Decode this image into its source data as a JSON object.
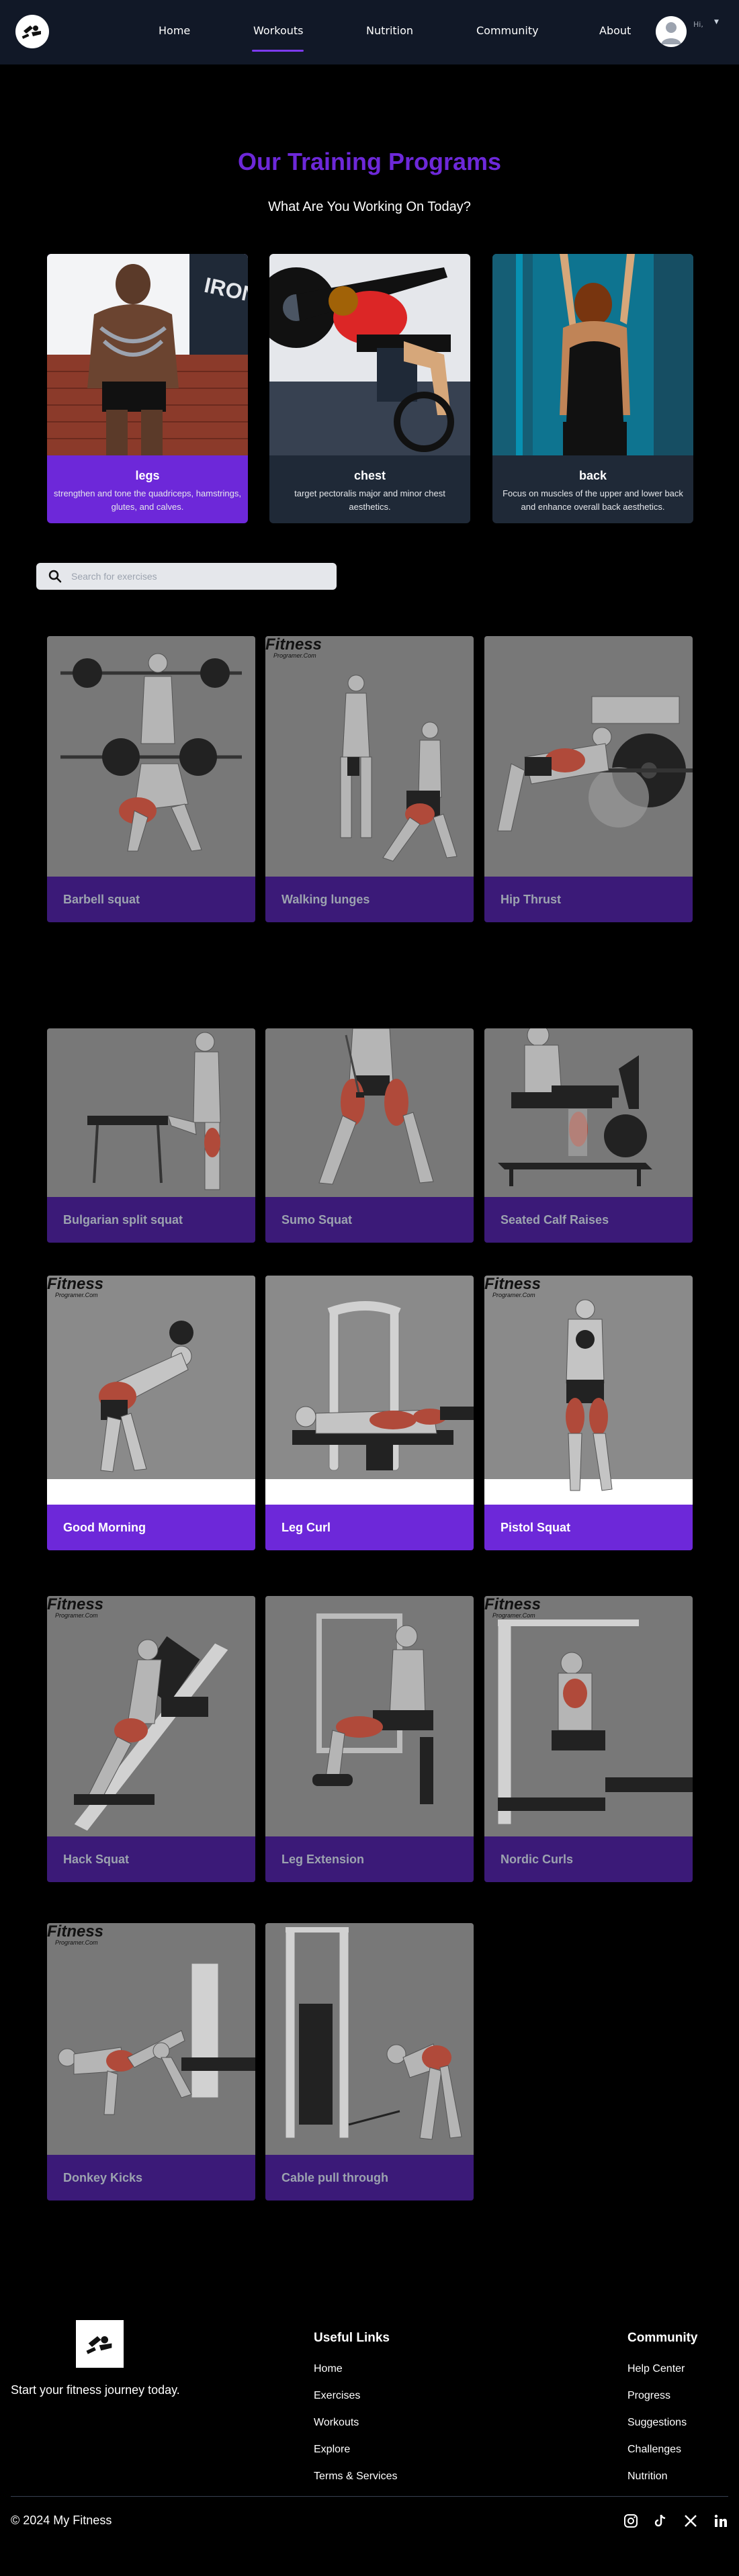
{
  "nav": {
    "links": [
      "Home",
      "Workouts",
      "Nutrition",
      "Community",
      "About"
    ],
    "active": "Workouts",
    "greeting": "Hi,",
    "accent": "#7c3aed"
  },
  "hero": {
    "title": "Our Training Programs",
    "subtitle": "What Are You Working On Today?"
  },
  "programs": [
    {
      "name": "legs",
      "description": "strengthen and tone the quadriceps, hamstrings, glutes, and calves."
    },
    {
      "name": "chest",
      "description": "target pectoralis major and minor chest aesthetics."
    },
    {
      "name": "back",
      "description": "Focus on muscles of the upper and lower back and enhance overall back aesthetics."
    }
  ],
  "search": {
    "placeholder": "Search for exercises"
  },
  "exercises": [
    "Barbell squat",
    "Walking lunges",
    "Hip Thrust",
    "Bulgarian split squat",
    "Sumo Squat",
    "Seated Calf Raises",
    "Good Morning",
    "Leg Curl",
    "Pistol Squat",
    "Hack Squat",
    "Leg Extension",
    "Nordic Curls",
    "Donkey Kicks",
    "Cable pull through"
  ],
  "image_watermark": {
    "brand": "Fitness",
    "sub": "Programer.Com"
  },
  "footer": {
    "tagline": "Start your fitness journey today.",
    "useful_links_title": "Useful Links",
    "useful_links": [
      "Home",
      "Exercises",
      "Workouts",
      "Explore",
      "Terms & Services"
    ],
    "community_title": "Community",
    "community_links": [
      "Help Center",
      "Progress",
      "Suggestions",
      "Challenges",
      "Nutrition"
    ],
    "copyright": "© 2024 My Fitness",
    "social_icons": [
      "instagram-icon",
      "tiktok-icon",
      "x-icon",
      "linkedin-icon"
    ]
  },
  "colors": {
    "brand_purple": "#6d28d9",
    "dark_label": "#3b1a78",
    "nav_bg": "#111827"
  }
}
